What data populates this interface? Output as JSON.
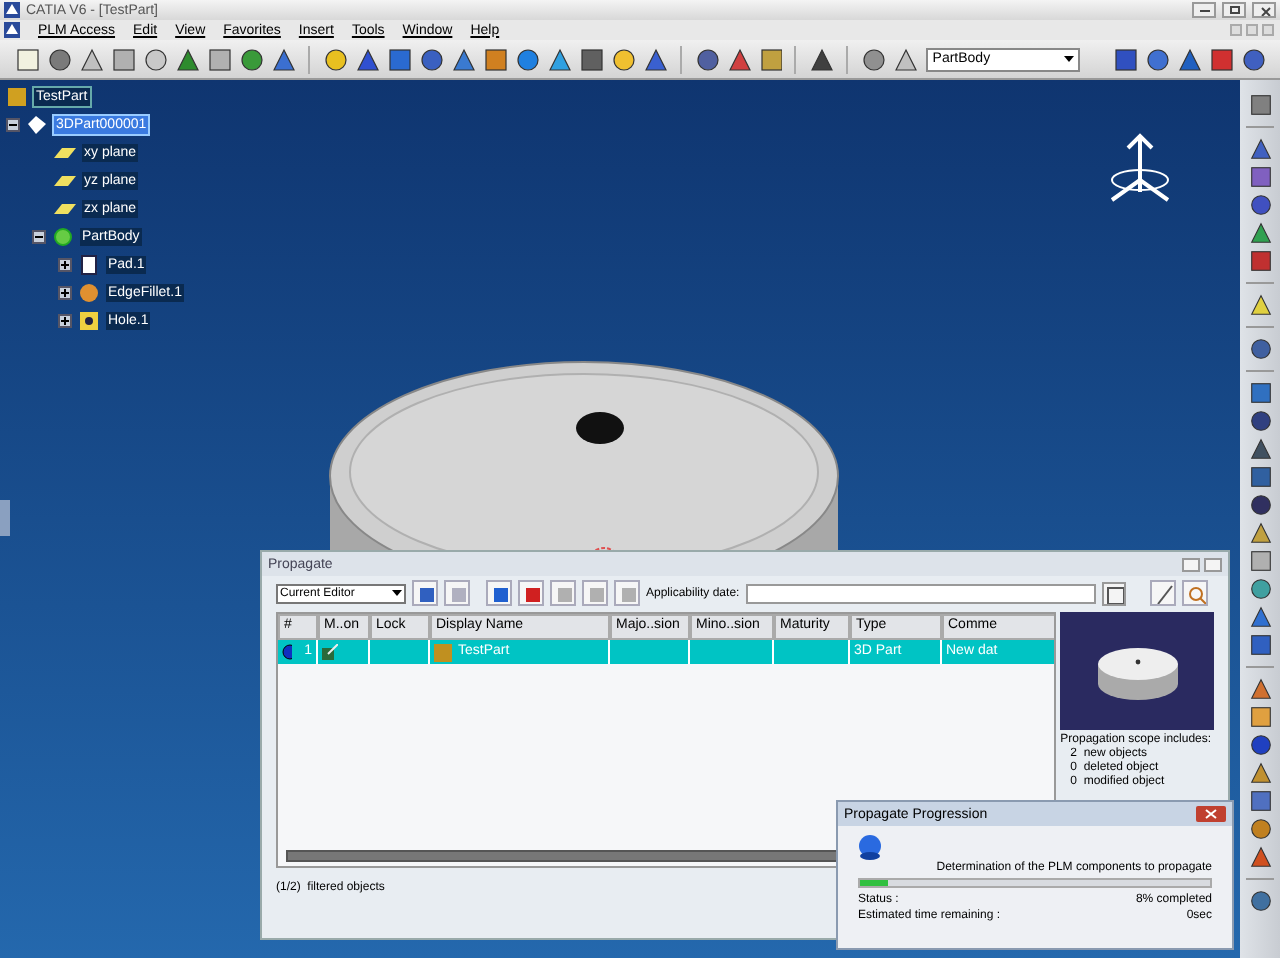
{
  "window": {
    "title": "CATIA V6 - [TestPart]"
  },
  "menu_bar": [
    "PLM Access",
    "Edit",
    "View",
    "Favorites",
    "Insert",
    "Tools",
    "Window",
    "Help"
  ],
  "toolbar": {
    "dropdown": "PartBody"
  },
  "tree": {
    "root": "TestPart",
    "children": [
      {
        "label": "3DPart000001",
        "kind": "part",
        "selected": true,
        "expanded": true,
        "children": [
          {
            "label": "xy plane",
            "kind": "plane",
            "selected": false
          },
          {
            "label": "yz plane",
            "kind": "plane",
            "selected": false
          },
          {
            "label": "zx plane",
            "kind": "plane",
            "selected": false
          },
          {
            "label": "PartBody",
            "kind": "body",
            "selected": false,
            "expanded": true,
            "children": [
              {
                "label": "Pad.1",
                "kind": "pad",
                "selected": false,
                "expanded": false
              },
              {
                "label": "EdgeFillet.1",
                "kind": "fillet",
                "selected": false,
                "expanded": false
              },
              {
                "label": "Hole.1",
                "kind": "hole",
                "selected": false,
                "expanded": false
              }
            ]
          }
        ]
      }
    ]
  },
  "propagate_dialog": {
    "title": "Propagate",
    "filter": "Current Editor",
    "applicability_label": "Applicability date:",
    "columns": [
      "#",
      "M..on",
      "Lock",
      "Display Name",
      "Majo..sion",
      "Mino..sion",
      "Maturity",
      "Type",
      "Comme"
    ],
    "rows": [
      {
        "selected": true,
        "cells": [
          "1",
          "",
          "",
          "TestPart",
          "",
          "",
          "",
          "3D Part",
          "New dat"
        ]
      }
    ],
    "scope_title": "Propagation scope includes:",
    "scope": [
      "2  new objects",
      "0  deleted object",
      "0  modified object"
    ],
    "status": "(1/2)  filtered objects"
  },
  "progress_dialog": {
    "title": "Propagate Progression",
    "message": "Determination of the PLM components to propagate",
    "level": 0.08,
    "status_label": "Status :",
    "status_value": "8% completed",
    "time_label": "Estimated time remaining :",
    "time_value": "0sec"
  }
}
